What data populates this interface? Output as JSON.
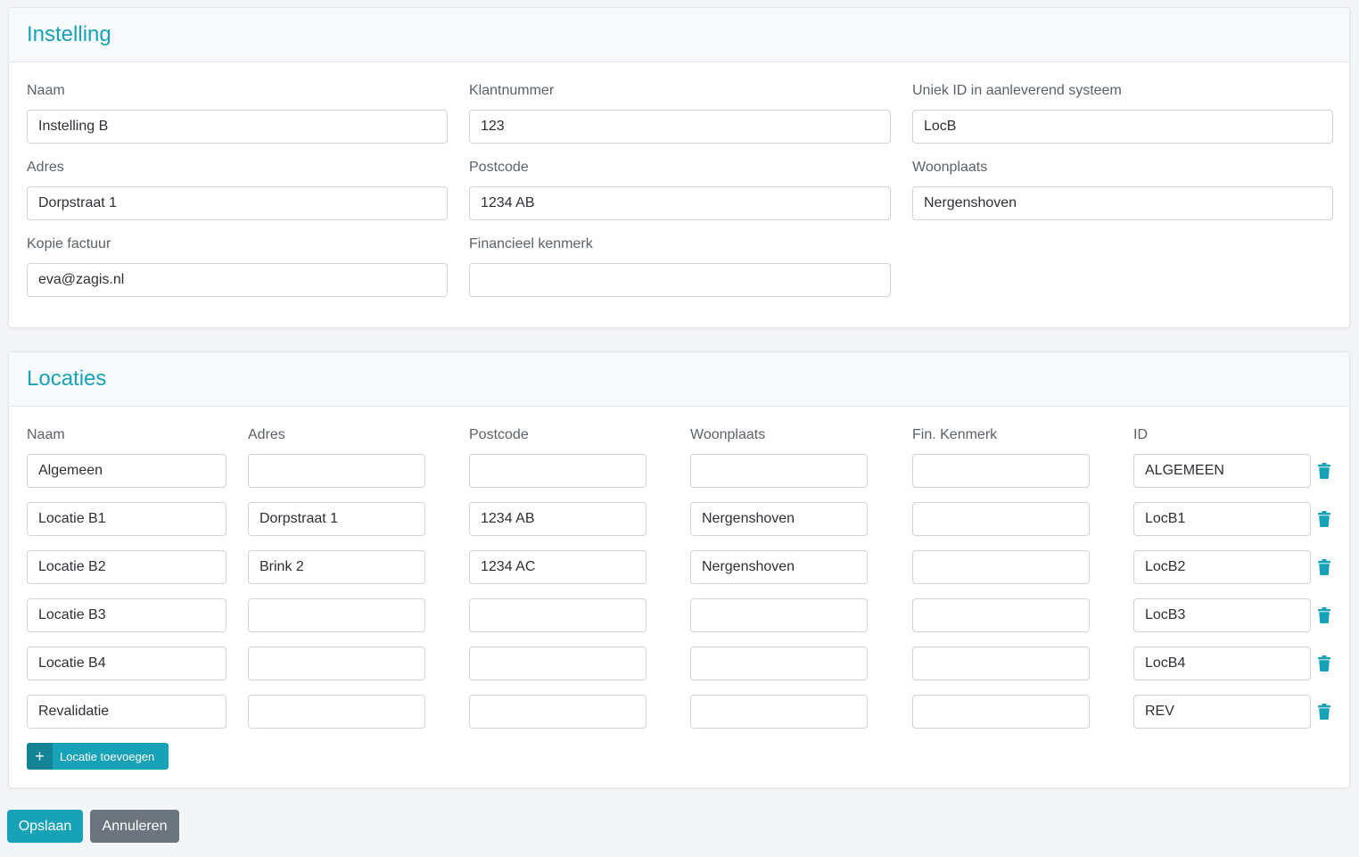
{
  "instelling": {
    "title": "Instelling",
    "fields": {
      "naam": {
        "label": "Naam",
        "value": "Instelling B"
      },
      "klantnummer": {
        "label": "Klantnummer",
        "value": "123"
      },
      "uniek_id": {
        "label": "Uniek ID in aanleverend systeem",
        "value": "LocB"
      },
      "adres": {
        "label": "Adres",
        "value": "Dorpstraat 1"
      },
      "postcode": {
        "label": "Postcode",
        "value": "1234 AB"
      },
      "woonplaats": {
        "label": "Woonplaats",
        "value": "Nergenshoven"
      },
      "kopie_factuur": {
        "label": "Kopie factuur",
        "value": "eva@zagis.nl"
      },
      "financieel_kenmerk": {
        "label": "Financieel kenmerk",
        "value": ""
      }
    }
  },
  "locaties": {
    "title": "Locaties",
    "columns": [
      "Naam",
      "Adres",
      "Postcode",
      "Woonplaats",
      "Fin. Kenmerk",
      "ID"
    ],
    "rows": [
      {
        "naam": "Algemeen",
        "adres": "",
        "postcode": "",
        "woonplaats": "",
        "fin_kenmerk": "",
        "id": "ALGEMEEN"
      },
      {
        "naam": "Locatie B1",
        "adres": "Dorpstraat 1",
        "postcode": "1234 AB",
        "woonplaats": "Nergenshoven",
        "fin_kenmerk": "",
        "id": "LocB1"
      },
      {
        "naam": "Locatie B2",
        "adres": "Brink 2",
        "postcode": "1234 AC",
        "woonplaats": "Nergenshoven",
        "fin_kenmerk": "",
        "id": "LocB2"
      },
      {
        "naam": "Locatie B3",
        "adres": "",
        "postcode": "",
        "woonplaats": "",
        "fin_kenmerk": "",
        "id": "LocB3"
      },
      {
        "naam": "Locatie B4",
        "adres": "",
        "postcode": "",
        "woonplaats": "",
        "fin_kenmerk": "",
        "id": "LocB4"
      },
      {
        "naam": "Revalidatie",
        "adres": "",
        "postcode": "",
        "woonplaats": "",
        "fin_kenmerk": "",
        "id": "REV"
      }
    ],
    "add_button": {
      "icon": "plus-icon",
      "label": "Locatie toevoegen"
    },
    "row_delete_icon": "trash-icon"
  },
  "actions": {
    "save_label": "Opslaan",
    "cancel_label": "Annuleren"
  },
  "colors": {
    "accent": "#17a2b8",
    "accent_dark": "#138496",
    "secondary": "#6c757d",
    "background": "#f4f5f7"
  }
}
